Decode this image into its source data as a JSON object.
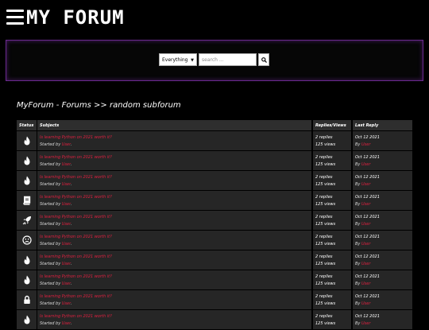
{
  "header": {
    "brand": "MY FORUM"
  },
  "search": {
    "scope_value": "Everything",
    "placeholder": "search ..."
  },
  "breadcrumb": "MyForum - Forums >> random subforum",
  "columns": {
    "status": "Status",
    "subjects": "Subjects",
    "replies_views": "Replies/Views",
    "last_reply": "Last Reply"
  },
  "labels": {
    "started_by": "Started by",
    "by": "By"
  },
  "rows": [
    {
      "icon": "fire-icon",
      "title": "Is learning Python on 2021 worth it?",
      "author": "User",
      "replies": "2 replies",
      "views": "125 views",
      "date": "Oct 12 2021",
      "last_user": "User"
    },
    {
      "icon": "fire-icon",
      "title": "Is learning Python on 2021 worth it?",
      "author": "User",
      "replies": "2 replies",
      "views": "125 views",
      "date": "Oct 12 2021",
      "last_user": "User"
    },
    {
      "icon": "fire-icon",
      "title": "Is learning Python on 2021 worth it?",
      "author": "User",
      "replies": "2 replies",
      "views": "125 views",
      "date": "Oct 12 2021",
      "last_user": "User"
    },
    {
      "icon": "book-icon",
      "title": "Is learning Python on 2021 worth it?",
      "author": "User",
      "replies": "2 replies",
      "views": "125 views",
      "date": "Oct 12 2021",
      "last_user": "User"
    },
    {
      "icon": "rocket-icon",
      "title": "Is learning Python on 2021 worth it?",
      "author": "User",
      "replies": "2 replies",
      "views": "125 views",
      "date": "Oct 12 2021",
      "last_user": "User"
    },
    {
      "icon": "sad-face-icon",
      "title": "Is learning Python on 2021 worth it?",
      "author": "User",
      "replies": "2 replies",
      "views": "125 views",
      "date": "Oct 12 2021",
      "last_user": "User"
    },
    {
      "icon": "fire-icon",
      "title": "Is learning Python on 2021 worth it?",
      "author": "User",
      "replies": "2 replies",
      "views": "125 views",
      "date": "Oct 12 2021",
      "last_user": "User"
    },
    {
      "icon": "fire-icon",
      "title": "Is learning Python on 2021 worth it?",
      "author": "User",
      "replies": "2 replies",
      "views": "125 views",
      "date": "Oct 12 2021",
      "last_user": "User"
    },
    {
      "icon": "lock-icon",
      "title": "Is learning Python on 2021 worth it?",
      "author": "User",
      "replies": "2 replies",
      "views": "125 views",
      "date": "Oct 12 2021",
      "last_user": "User"
    },
    {
      "icon": "fire-icon",
      "title": "Is learning Python on 2021 worth it?",
      "author": "User",
      "replies": "2 replies",
      "views": "125 views",
      "date": "Oct 12 2021",
      "last_user": "User"
    }
  ]
}
